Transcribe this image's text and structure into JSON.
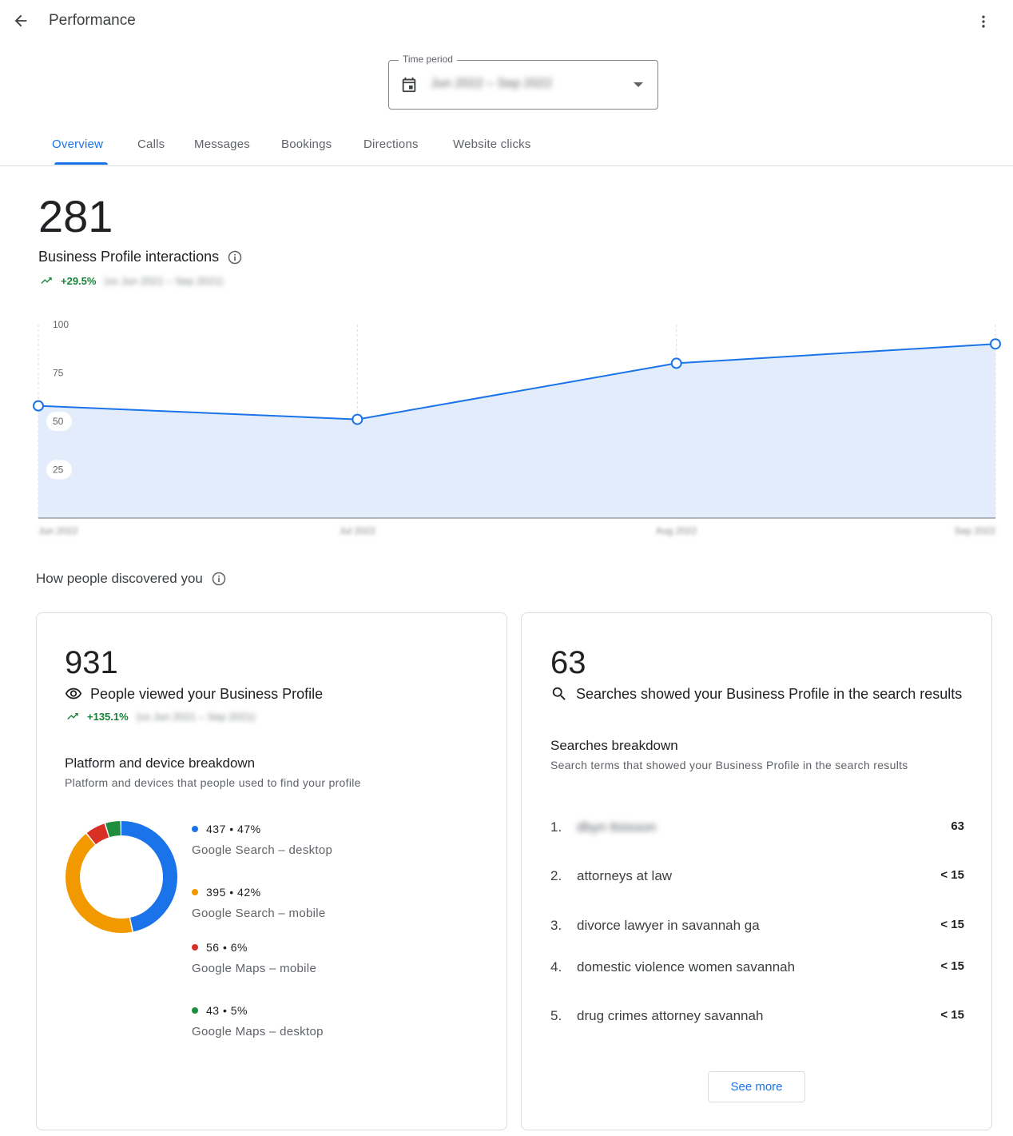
{
  "header": {
    "title": "Performance"
  },
  "time_period": {
    "label": "Time period",
    "value": "Jun 2022 – Sep 2022"
  },
  "tabs": [
    {
      "label": "Overview",
      "active": true
    },
    {
      "label": "Calls"
    },
    {
      "label": "Messages"
    },
    {
      "label": "Bookings"
    },
    {
      "label": "Directions"
    },
    {
      "label": "Website clicks"
    }
  ],
  "interactions": {
    "total": "281",
    "label": "Business Profile interactions",
    "change": "+29.5%",
    "comparison": "(vs Jun 2021 – Sep 2021)"
  },
  "chart_data": {
    "type": "area",
    "categories": [
      "Jun 2022",
      "Jul 2022",
      "Aug 2022",
      "Sep 2022"
    ],
    "values": [
      58,
      51,
      80,
      90
    ],
    "yticks": [
      25,
      50,
      75,
      100
    ],
    "ylim": [
      0,
      100
    ],
    "color": "#1a73e8",
    "fill": "#e3ecfb"
  },
  "discovery": {
    "title": "How people discovered you"
  },
  "views": {
    "total": "931",
    "label": "People viewed your Business Profile",
    "change": "+135.1%",
    "comparison": "(vs Jun 2021 – Sep 2021)",
    "breakdown_title": "Platform and device breakdown",
    "breakdown_desc": "Platform and devices that people used to find your profile",
    "donut": [
      {
        "value": 437,
        "percent": 47,
        "display": "437 • 47%",
        "name": "Google Search – desktop",
        "color": "#1a73e8"
      },
      {
        "value": 395,
        "percent": 42,
        "display": "395 • 42%",
        "name": "Google Search – mobile",
        "color": "#f29900"
      },
      {
        "value": 56,
        "percent": 6,
        "display": "56 • 6%",
        "name": "Google Maps – mobile",
        "color": "#d93025"
      },
      {
        "value": 43,
        "percent": 5,
        "display": "43 • 5%",
        "name": "Google Maps – desktop",
        "color": "#1e8e3e"
      }
    ]
  },
  "searches": {
    "total": "63",
    "label": "Searches showed your Business Profile in the search results",
    "breakdown_title": "Searches breakdown",
    "breakdown_desc": "Search terms that showed your Business Profile in the search results",
    "rows": [
      {
        "rank": "1.",
        "term": "dbyn ttsisson",
        "count": "63"
      },
      {
        "rank": "2.",
        "term": "attorneys at law",
        "count": "< 15"
      },
      {
        "rank": "3.",
        "term": "divorce lawyer in savannah ga",
        "count": "< 15"
      },
      {
        "rank": "4.",
        "term": "domestic violence women savannah",
        "count": "< 15"
      },
      {
        "rank": "5.",
        "term": "drug crimes attorney savannah",
        "count": "< 15"
      }
    ],
    "see_more": "See more"
  }
}
